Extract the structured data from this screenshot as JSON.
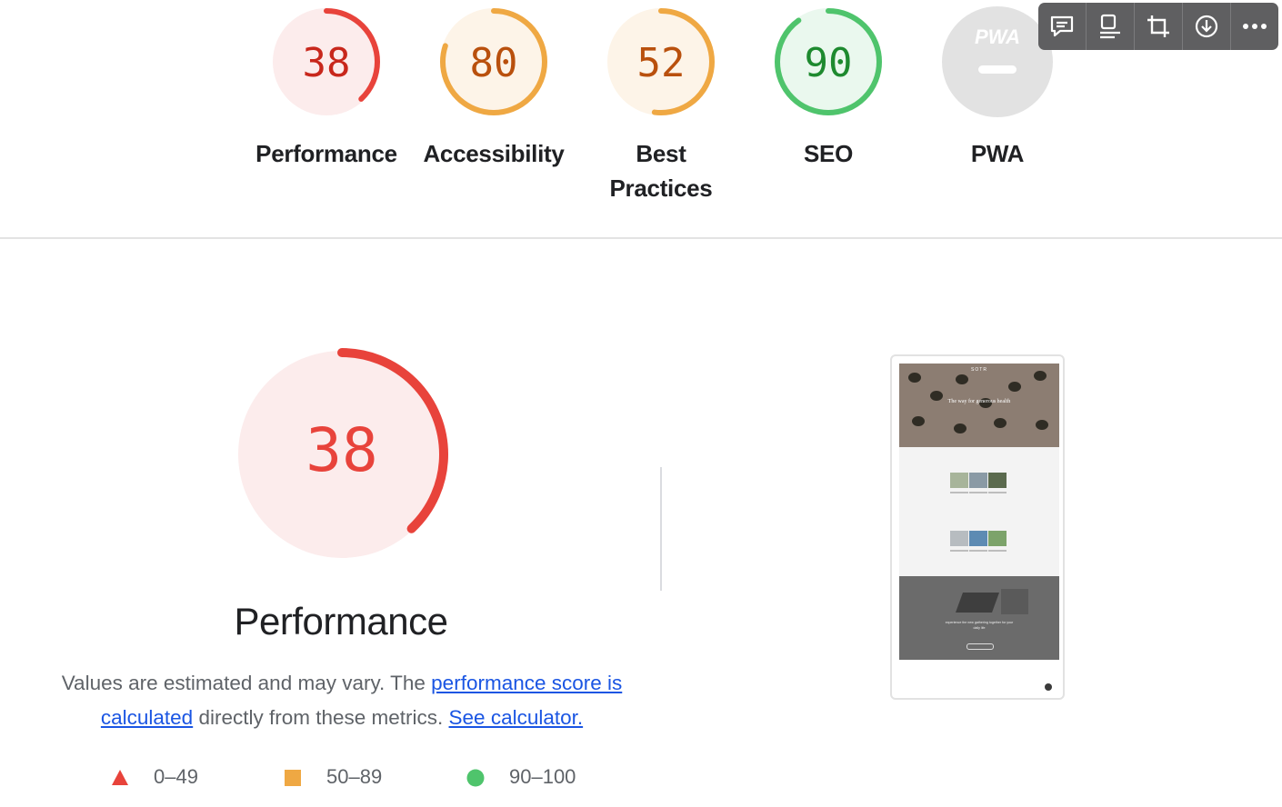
{
  "categories": [
    {
      "id": "performance",
      "label_lines": [
        "Performance"
      ],
      "score": "38",
      "fraction": 0.38,
      "rating": "fail"
    },
    {
      "id": "accessibility",
      "label_lines": [
        "Accessibility"
      ],
      "score": "80",
      "fraction": 0.8,
      "rating": "average"
    },
    {
      "id": "best-practices",
      "label_lines": [
        "Best",
        "Practices"
      ],
      "score": "52",
      "fraction": 0.52,
      "rating": "average"
    },
    {
      "id": "seo",
      "label_lines": [
        "SEO"
      ],
      "score": "90",
      "fraction": 0.9,
      "rating": "pass"
    },
    {
      "id": "pwa",
      "label_lines": [
        "PWA"
      ],
      "badge": "PWA",
      "rating": "na"
    }
  ],
  "colors": {
    "fail": {
      "arc": "#e8433b",
      "bg": "#fcecec",
      "text": "#c8271c"
    },
    "average": {
      "arc": "#efa843",
      "bg": "#fdf4e8",
      "text": "#b9500d"
    },
    "pass": {
      "arc": "#4fc46c",
      "bg": "#eaf8ee",
      "text": "#1e8a2f"
    },
    "na": {
      "arc": "#dadada",
      "bg": "#e2e2e2",
      "text": "#ffffff"
    },
    "link": "#1a55e3",
    "toolbar": "#5f5f61"
  },
  "toolbar": {
    "buttons": [
      {
        "id": "comment",
        "icon": "comment-icon"
      },
      {
        "id": "screenshot",
        "icon": "screenshot-icon"
      },
      {
        "id": "crop",
        "icon": "crop-icon"
      },
      {
        "id": "download",
        "icon": "download-icon"
      },
      {
        "id": "more",
        "icon": "more-icon"
      }
    ]
  },
  "main": {
    "score": "38",
    "fraction": 0.38,
    "title": "Performance",
    "desc_text1": "Values are estimated and may vary. The ",
    "desc_link1": "performance score is calculated",
    "desc_text2": " directly from these metrics. ",
    "desc_link2": "See calculator."
  },
  "legend": [
    {
      "shape": "triangle",
      "color": "#e8433b",
      "label": "0–49"
    },
    {
      "shape": "square",
      "color": "#efa843",
      "label": "50–89"
    },
    {
      "shape": "circle",
      "color": "#4fc46c",
      "label": "90–100"
    }
  ],
  "preview": {
    "brand": "SOTR",
    "headline": "The way for generous health",
    "dark_caption": "experience the new gathering together for your daily life"
  }
}
